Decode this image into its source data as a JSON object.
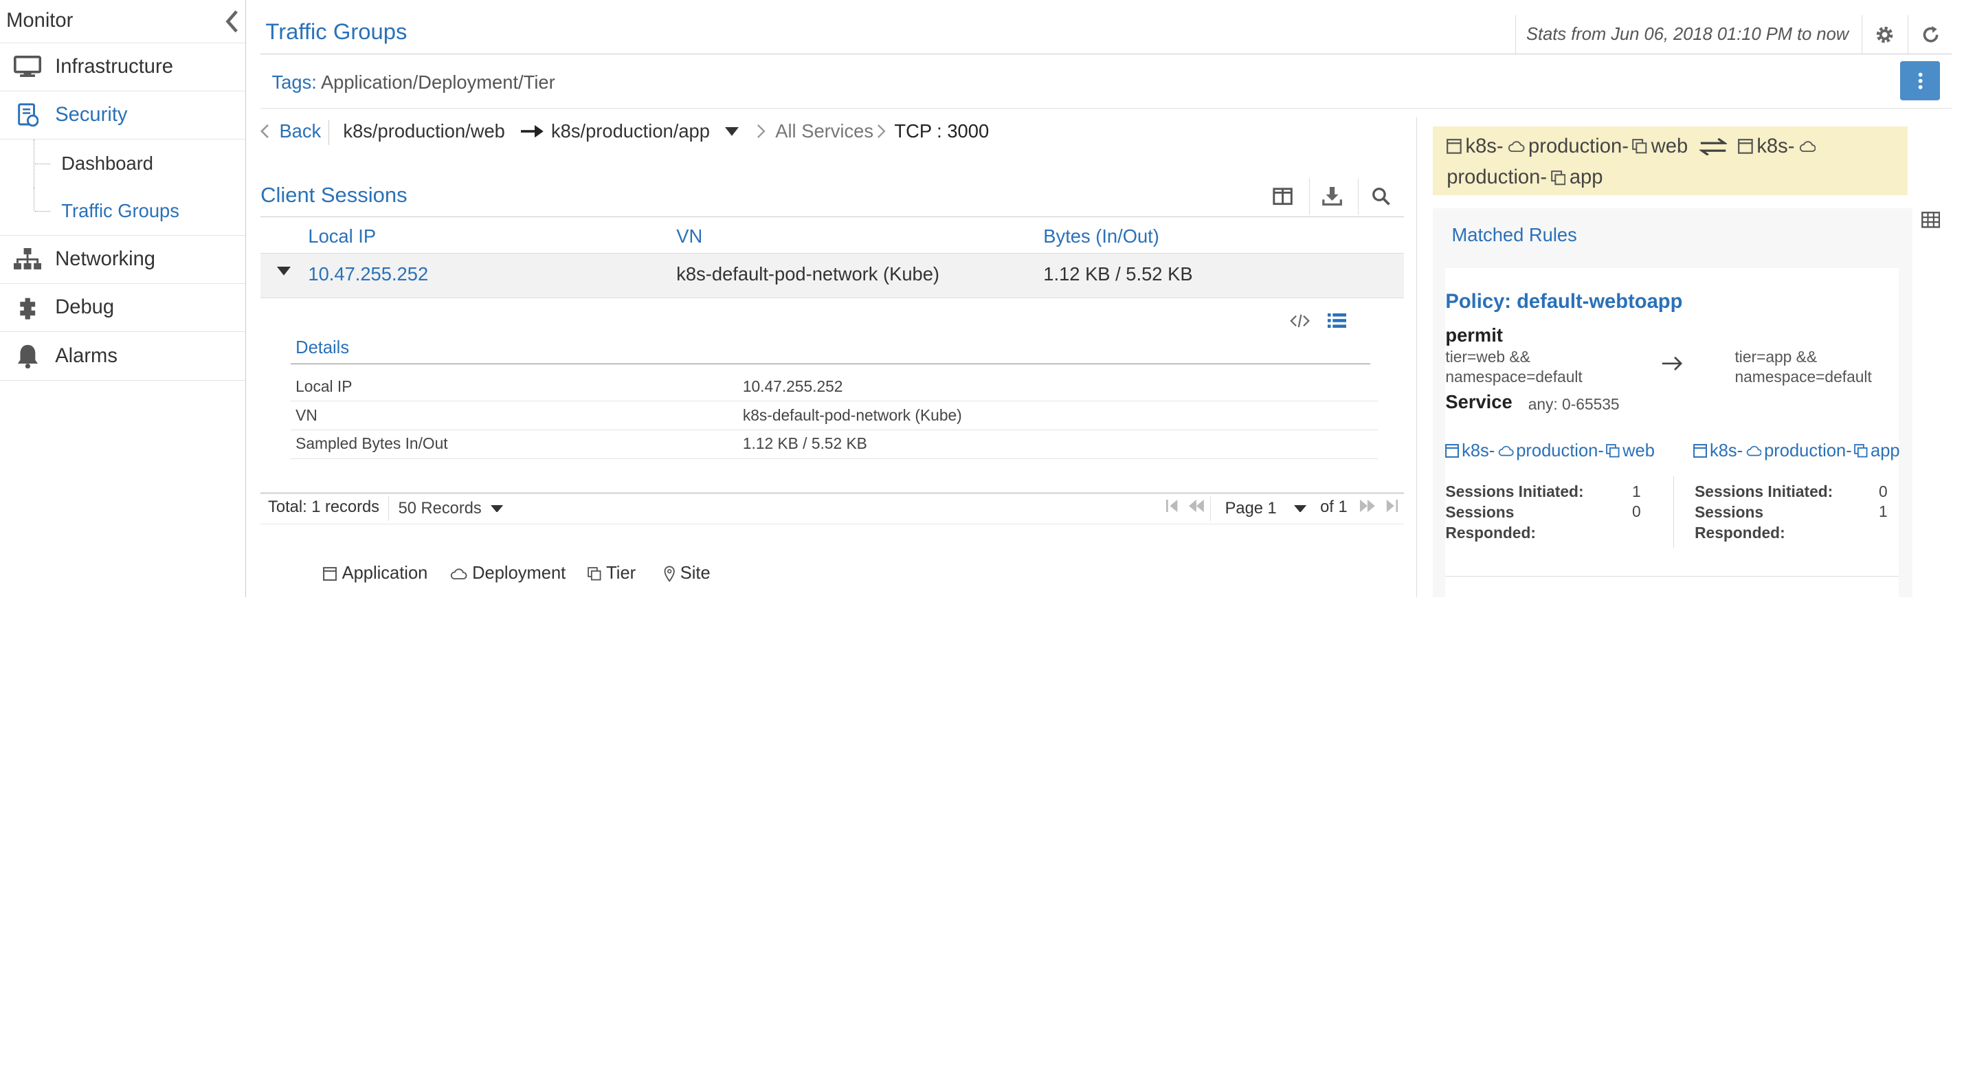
{
  "sidebar": {
    "title": "Monitor",
    "items": [
      {
        "label": "Infrastructure",
        "icon": "monitor-icon"
      },
      {
        "label": "Security",
        "icon": "shield-icon",
        "active": true
      },
      {
        "label": "Networking",
        "icon": "network-icon"
      },
      {
        "label": "Debug",
        "icon": "bug-icon"
      },
      {
        "label": "Alarms",
        "icon": "bell-icon"
      }
    ],
    "security_sub": [
      {
        "label": "Dashboard"
      },
      {
        "label": "Traffic Groups",
        "active": true
      }
    ]
  },
  "header": {
    "title": "Traffic Groups",
    "stats": "Stats from Jun 06, 2018 01:10 PM to now"
  },
  "tags": {
    "label": "Tags:",
    "value": "Application/Deployment/Tier"
  },
  "breadcrumb": {
    "back": "Back",
    "source": "k8s/production/web",
    "dest": "k8s/production/app",
    "services": "All Services",
    "port": "TCP : 3000"
  },
  "sessions": {
    "title": "Client Sessions",
    "columns": [
      "Local IP",
      "VN",
      "Bytes (In/Out)"
    ],
    "rows": [
      {
        "local_ip": "10.47.255.252",
        "vn": "k8s-default-pod-network (Kube)",
        "bytes": "1.12 KB / 5.52 KB"
      }
    ],
    "details": {
      "title": "Details",
      "rows": [
        {
          "label": "Local IP",
          "value": "10.47.255.252"
        },
        {
          "label": "VN",
          "value": "k8s-default-pod-network (Kube)"
        },
        {
          "label": "Sampled Bytes In/Out",
          "value": "1.12 KB / 5.52 KB"
        }
      ]
    },
    "footer": {
      "total": "Total: 1 records",
      "page_size": "50 Records",
      "page": "Page 1",
      "of": "of 1"
    }
  },
  "legend": [
    "Application",
    "Deployment",
    "Tier",
    "Site"
  ],
  "flow": {
    "src_app": "k8s-",
    "src_dep": "production-",
    "src_tier": "web",
    "dst_app": "k8s-",
    "dst_dep": "production-",
    "dst_tier": "app"
  },
  "rules": {
    "title": "Matched Rules",
    "policy": "Policy: default-webtoapp",
    "action": "permit",
    "src_match": [
      "tier=web &&",
      "namespace=default"
    ],
    "dst_match": [
      "tier=app &&",
      "namespace=default"
    ],
    "service_label": "Service",
    "service_value": "any: 0-65535",
    "src_node": {
      "app": "k8s-",
      "dep": "production-",
      "tier": "web"
    },
    "dst_node": {
      "app": "k8s-",
      "dep": "production-",
      "tier": "app"
    },
    "src_stats": {
      "initiated_label": "Sessions Initiated:",
      "initiated": "1",
      "responded_label_1": "Sessions",
      "responded_label_2": "Responded:",
      "responded": "0"
    },
    "dst_stats": {
      "initiated_label": "Sessions Initiated:",
      "initiated": "0",
      "responded_label_1": "Sessions",
      "responded_label_2": "Responded:",
      "responded": "1"
    }
  },
  "colors": {
    "accent": "#2a71b8",
    "flow_bg": "#f7f0c8",
    "kebab_bg": "#4a8dc8",
    "row_bg": "#f2f2f2"
  }
}
